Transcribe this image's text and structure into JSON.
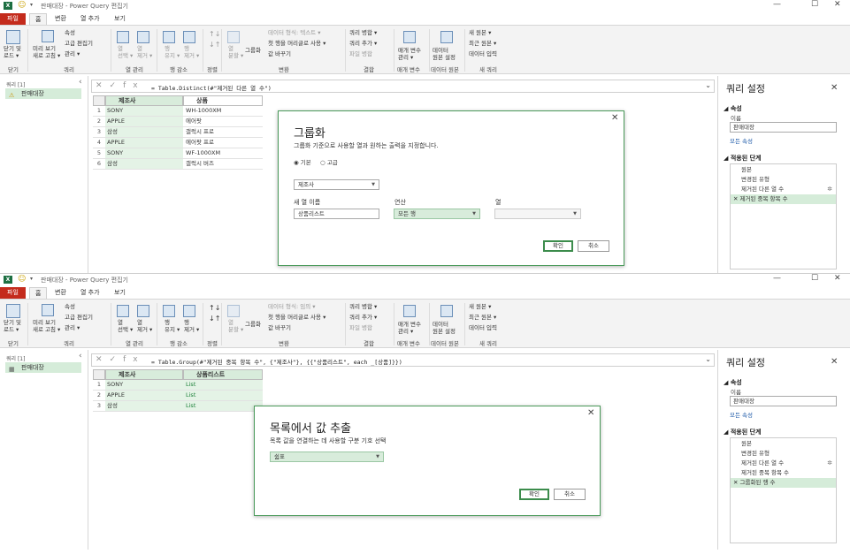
{
  "window1": {
    "title": "판매대장 - Power Query 편집기",
    "tabs": [
      "파일",
      "홈",
      "변환",
      "열 추가",
      "보기"
    ],
    "ribbon": {
      "close_load": "닫기 및\n로드 ▾",
      "preview": "미리 보기\n새로 고침 ▾",
      "properties": "속성",
      "adv_editor": "고급 편집기",
      "manage": "관리 ▾",
      "choose_cols": "열\n선택 ▾",
      "remove_cols": "열\n제거 ▾",
      "keep_rows": "행\n유지 ▾",
      "remove_rows": "행\n제거 ▾",
      "split": "열\n분할 ▾",
      "groupby": "그룹화",
      "datatype": "데이터 형식: 텍스트 ▾",
      "first_row": "첫 행을 머리글로 사용 ▾",
      "replace": "값 바꾸기",
      "merge": "쿼리 병합 ▾",
      "append": "쿼리 추가 ▾",
      "combine": "파일 병합",
      "params": "매개 변수\n관리 ▾",
      "ds": "데이터\n원본 설정",
      "newsrc": "새 원본 ▾",
      "recent": "최근 원본 ▾",
      "enter": "데이터 입력"
    },
    "groups": [
      "닫기",
      "쿼리",
      "열 관리",
      "행 감소",
      "정렬",
      "변환",
      "결합",
      "매개 변수",
      "데이터 원본",
      "새 쿼리"
    ],
    "queries_label": "쿼리 [1]",
    "query_name": "판매대장",
    "formula": "= Table.Distinct(#\"제거된 다른 열 수\")",
    "columns": [
      {
        "type": "ABC",
        "name": "제조사"
      },
      {
        "type": "ABC",
        "name": "상품"
      }
    ],
    "rows": [
      [
        "1",
        "SONY",
        "WH-1000XM"
      ],
      [
        "2",
        "APPLE",
        "에어팟"
      ],
      [
        "3",
        "삼성",
        "갤럭시 프로"
      ],
      [
        "4",
        "APPLE",
        "에어팟 프로"
      ],
      [
        "5",
        "SONY",
        "WF-1000XM"
      ],
      [
        "6",
        "삼성",
        "갤럭시 버즈"
      ]
    ],
    "dialog": {
      "title": "그룹화",
      "desc": "그룹화 기준으로 사용할 열과 원하는 출력을 지정합니다.",
      "basic": "◉ 기본",
      "advanced": "○ 고급",
      "groupcol": "제조사",
      "newcol_label": "새 열 이름",
      "op_label": "연산",
      "col_label": "열",
      "newcol": "상품리스트",
      "op": "모든 행",
      "ok": "확인",
      "cancel": "취소"
    },
    "settings": {
      "title": "쿼리 설정",
      "props": "◢ 속성",
      "name_label": "이름",
      "name": "판매대장",
      "all_props": "모든 속성",
      "steps_head": "◢ 적용된 단계",
      "steps": [
        "원본",
        "변경된 유형",
        "제거된 다른 열 수",
        "✕ 제거된 중복 항목 수"
      ]
    }
  },
  "window2": {
    "title": "판매대장 - Power Query 편집기",
    "datatype": "데이터 형식: 임의 ▾",
    "queries_label": "쿼리 [1]",
    "query_name": "판매대장",
    "formula": "= Table.Group(#\"제거된 중복 항목 수\", {\"제조사\"}, {{\"상품리스트\", each _[상품]}})",
    "columns": [
      {
        "type": "ABC",
        "name": "제조사"
      },
      {
        "type": "ABC 123",
        "name": "상품리스트"
      }
    ],
    "rows": [
      [
        "1",
        "SONY",
        "List"
      ],
      [
        "2",
        "APPLE",
        "List"
      ],
      [
        "3",
        "삼성",
        "List"
      ]
    ],
    "dialog": {
      "title": "목록에서 값 추출",
      "desc": "목록 값을 연결하는 데 사용할 구분 기호 선택",
      "sep": "쉼표",
      "ok": "확인",
      "cancel": "취소"
    },
    "settings": {
      "title": "쿼리 설정",
      "props": "◢ 속성",
      "name_label": "이름",
      "name": "판매대장",
      "all_props": "모든 속성",
      "steps_head": "◢ 적용된 단계",
      "steps": [
        "원본",
        "변경된 유형",
        "제거된 다른 열 수",
        "제거된 중복 항목 수",
        "✕ 그룹화된 행 수"
      ]
    }
  }
}
